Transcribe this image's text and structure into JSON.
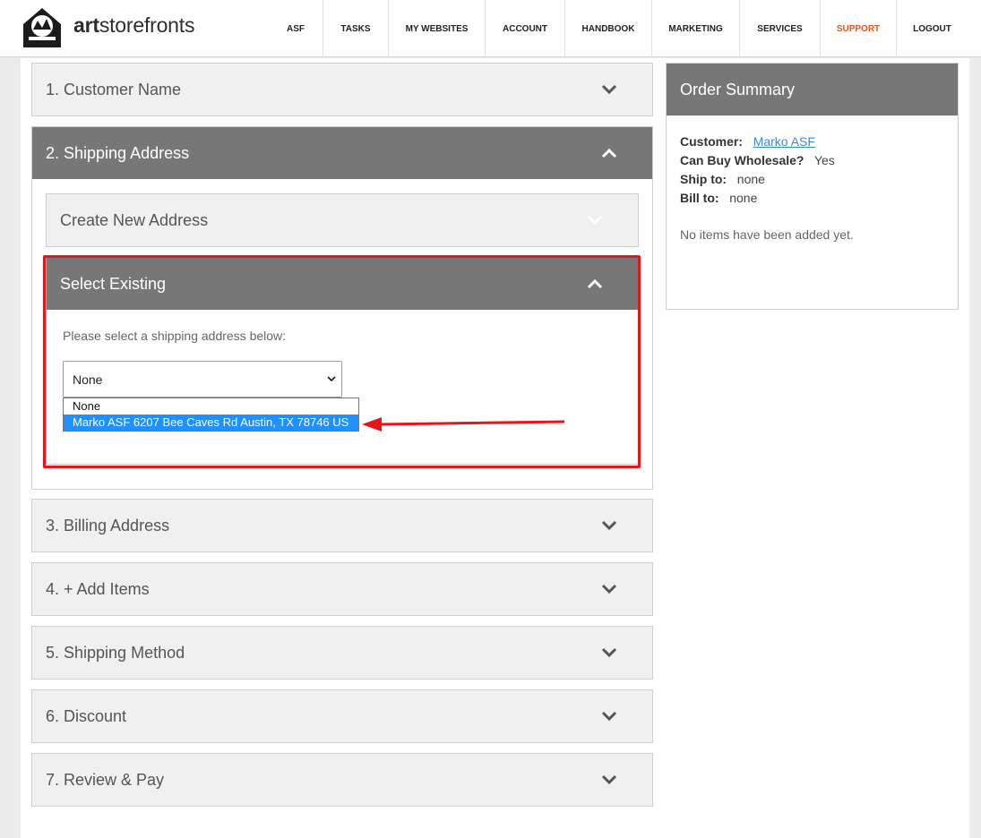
{
  "header": {
    "brand": {
      "art": "art",
      "rest": "storefronts"
    },
    "nav": [
      {
        "label": "ASF",
        "width": 60
      },
      {
        "label": "TASKS",
        "width": 73
      },
      {
        "label": "MY WEBSITES",
        "width": 108
      },
      {
        "label": "ACCOUNT",
        "width": 89
      },
      {
        "label": "HANDBOOK",
        "width": 97
      },
      {
        "label": "MARKETING",
        "width": 98
      },
      {
        "label": "SERVICES",
        "width": 90
      },
      {
        "label": "SUPPORT",
        "width": 85
      },
      {
        "label": "LOGOUT",
        "width": 80
      }
    ]
  },
  "steps": {
    "customer_name": "1. Customer Name",
    "shipping_address": "2. Shipping Address",
    "billing_address": "3. Billing Address",
    "add_items": "4. + Add Items",
    "shipping_method": "5. Shipping Method",
    "discount": "6. Discount",
    "review_pay": "7. Review & Pay"
  },
  "shipping": {
    "create_new": "Create New Address",
    "select_existing": "Select Existing",
    "prompt": "Please select a shipping address below:",
    "select_value": "None",
    "options": [
      "None",
      "Marko ASF 6207 Bee Caves Rd Austin, TX 78746 US"
    ]
  },
  "summary": {
    "title": "Order Summary",
    "customer_label": "Customer:",
    "customer_value": "Marko ASF",
    "wholesale_label": "Can Buy Wholesale?",
    "wholesale_value": "Yes",
    "ship_label": "Ship to:",
    "ship_value": "none",
    "bill_label": "Bill to:",
    "bill_value": "none",
    "empty_note": "No items have been added yet."
  },
  "colors": {
    "panel_dark": "#777777",
    "support": "#e8541c",
    "highlight": "#e8141b",
    "option_selected": "#1e90ff"
  }
}
